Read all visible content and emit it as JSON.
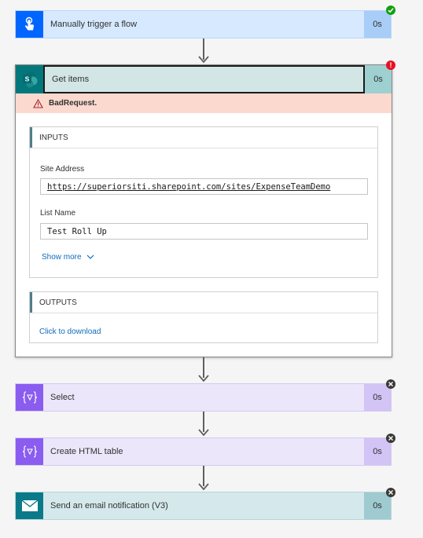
{
  "steps": {
    "trigger": {
      "title": "Manually trigger a flow",
      "duration": "0s",
      "status": "succeeded",
      "icon": "touch-hand-icon",
      "color": "#0066ff"
    },
    "get_items": {
      "title": "Get items",
      "duration": "0s",
      "status": "failed",
      "icon": "sharepoint-icon",
      "color": "#03787c",
      "error": "BadRequest.",
      "inputs": {
        "heading": "INPUTS",
        "site_address_label": "Site Address",
        "site_address_value": "https://superiorsiti.sharepoint.com/sites/ExpenseTeamDemo",
        "list_name_label": "List Name",
        "list_name_value": "Test Roll Up",
        "show_more": "Show more"
      },
      "outputs": {
        "heading": "OUTPUTS",
        "download": "Click to download"
      }
    },
    "select": {
      "title": "Select",
      "duration": "0s",
      "status": "skipped",
      "icon": "data-operation-icon",
      "color": "#8a5cf0"
    },
    "html_table": {
      "title": "Create HTML table",
      "duration": "0s",
      "status": "skipped",
      "icon": "data-operation-icon",
      "color": "#8a5cf0"
    },
    "email": {
      "title": "Send an email notification (V3)",
      "duration": "0s",
      "status": "skipped",
      "icon": "mail-icon",
      "color": "#0a7a8a"
    }
  }
}
